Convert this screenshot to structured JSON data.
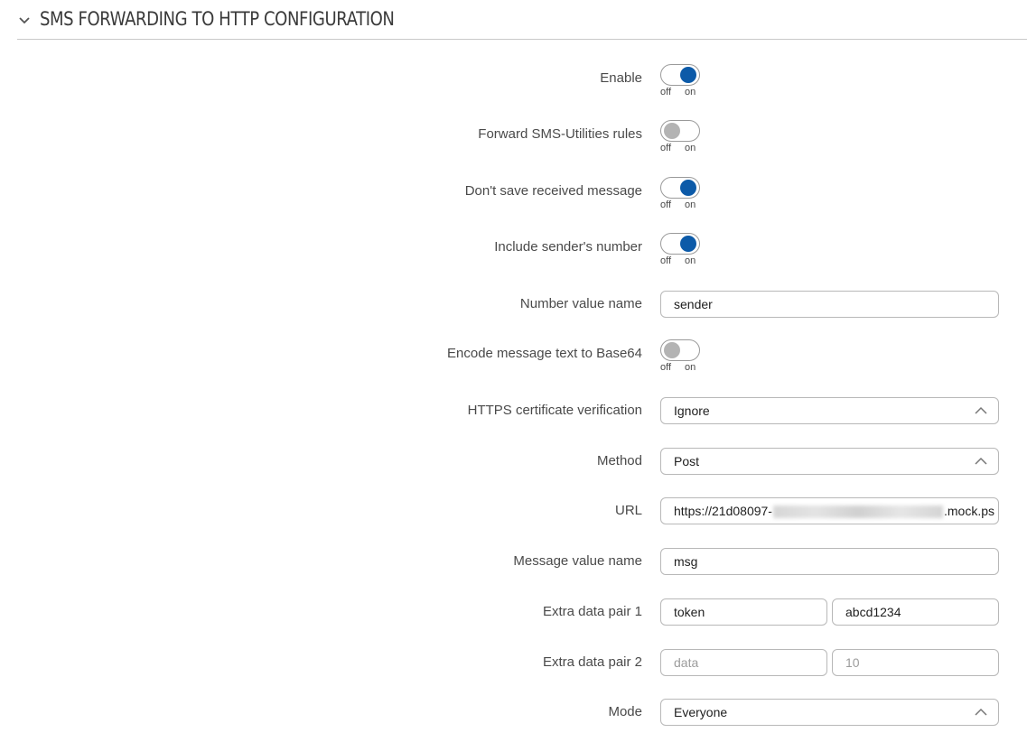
{
  "section": {
    "title": "SMS FORWARDING TO HTTP CONFIGURATION"
  },
  "toggle_caps": {
    "off": "off",
    "on": "on"
  },
  "fields": {
    "enable": {
      "label": "Enable",
      "state": "on"
    },
    "forward_rules": {
      "label": "Forward SMS-Utilities rules",
      "state": "off"
    },
    "dont_save": {
      "label": "Don't save received message",
      "state": "on"
    },
    "include_sender": {
      "label": "Include sender's number",
      "state": "on"
    },
    "number_value_name": {
      "label": "Number value name",
      "value": "sender"
    },
    "encode_base64": {
      "label": "Encode message text to Base64",
      "state": "off"
    },
    "https_verification": {
      "label": "HTTPS certificate verification",
      "value": "Ignore"
    },
    "method": {
      "label": "Method",
      "value": "Post"
    },
    "url": {
      "label": "URL",
      "value_prefix": "https://21d08097-",
      "value_suffix": ".mock.ps"
    },
    "message_value_name": {
      "label": "Message value name",
      "value": "msg"
    },
    "extra_pair_1": {
      "label": "Extra data pair 1",
      "key": "token",
      "value": "abcd1234"
    },
    "extra_pair_2": {
      "label": "Extra data pair 2",
      "key_placeholder": "data",
      "value_placeholder": "10"
    },
    "mode": {
      "label": "Mode",
      "value": "Everyone"
    }
  },
  "colors": {
    "toggle_on": "#0c5aa8",
    "toggle_off": "#b3b3b3"
  }
}
